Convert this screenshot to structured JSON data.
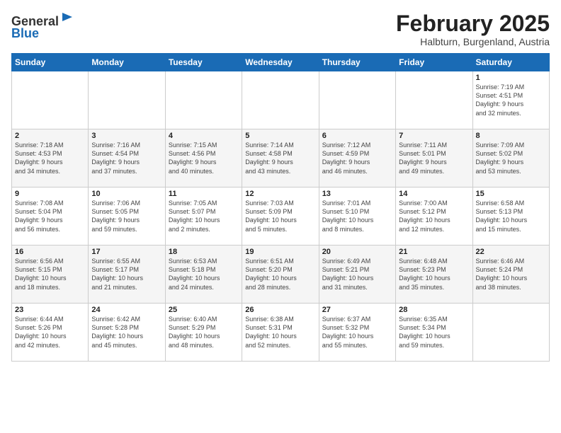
{
  "header": {
    "logo_line1": "General",
    "logo_line2": "Blue",
    "title": "February 2025",
    "subtitle": "Halbturn, Burgenland, Austria"
  },
  "days_of_week": [
    "Sunday",
    "Monday",
    "Tuesday",
    "Wednesday",
    "Thursday",
    "Friday",
    "Saturday"
  ],
  "weeks": [
    [
      {
        "day": "",
        "info": ""
      },
      {
        "day": "",
        "info": ""
      },
      {
        "day": "",
        "info": ""
      },
      {
        "day": "",
        "info": ""
      },
      {
        "day": "",
        "info": ""
      },
      {
        "day": "",
        "info": ""
      },
      {
        "day": "1",
        "info": "Sunrise: 7:19 AM\nSunset: 4:51 PM\nDaylight: 9 hours\nand 32 minutes."
      }
    ],
    [
      {
        "day": "2",
        "info": "Sunrise: 7:18 AM\nSunset: 4:53 PM\nDaylight: 9 hours\nand 34 minutes."
      },
      {
        "day": "3",
        "info": "Sunrise: 7:16 AM\nSunset: 4:54 PM\nDaylight: 9 hours\nand 37 minutes."
      },
      {
        "day": "4",
        "info": "Sunrise: 7:15 AM\nSunset: 4:56 PM\nDaylight: 9 hours\nand 40 minutes."
      },
      {
        "day": "5",
        "info": "Sunrise: 7:14 AM\nSunset: 4:58 PM\nDaylight: 9 hours\nand 43 minutes."
      },
      {
        "day": "6",
        "info": "Sunrise: 7:12 AM\nSunset: 4:59 PM\nDaylight: 9 hours\nand 46 minutes."
      },
      {
        "day": "7",
        "info": "Sunrise: 7:11 AM\nSunset: 5:01 PM\nDaylight: 9 hours\nand 49 minutes."
      },
      {
        "day": "8",
        "info": "Sunrise: 7:09 AM\nSunset: 5:02 PM\nDaylight: 9 hours\nand 53 minutes."
      }
    ],
    [
      {
        "day": "9",
        "info": "Sunrise: 7:08 AM\nSunset: 5:04 PM\nDaylight: 9 hours\nand 56 minutes."
      },
      {
        "day": "10",
        "info": "Sunrise: 7:06 AM\nSunset: 5:05 PM\nDaylight: 9 hours\nand 59 minutes."
      },
      {
        "day": "11",
        "info": "Sunrise: 7:05 AM\nSunset: 5:07 PM\nDaylight: 10 hours\nand 2 minutes."
      },
      {
        "day": "12",
        "info": "Sunrise: 7:03 AM\nSunset: 5:09 PM\nDaylight: 10 hours\nand 5 minutes."
      },
      {
        "day": "13",
        "info": "Sunrise: 7:01 AM\nSunset: 5:10 PM\nDaylight: 10 hours\nand 8 minutes."
      },
      {
        "day": "14",
        "info": "Sunrise: 7:00 AM\nSunset: 5:12 PM\nDaylight: 10 hours\nand 12 minutes."
      },
      {
        "day": "15",
        "info": "Sunrise: 6:58 AM\nSunset: 5:13 PM\nDaylight: 10 hours\nand 15 minutes."
      }
    ],
    [
      {
        "day": "16",
        "info": "Sunrise: 6:56 AM\nSunset: 5:15 PM\nDaylight: 10 hours\nand 18 minutes."
      },
      {
        "day": "17",
        "info": "Sunrise: 6:55 AM\nSunset: 5:17 PM\nDaylight: 10 hours\nand 21 minutes."
      },
      {
        "day": "18",
        "info": "Sunrise: 6:53 AM\nSunset: 5:18 PM\nDaylight: 10 hours\nand 24 minutes."
      },
      {
        "day": "19",
        "info": "Sunrise: 6:51 AM\nSunset: 5:20 PM\nDaylight: 10 hours\nand 28 minutes."
      },
      {
        "day": "20",
        "info": "Sunrise: 6:49 AM\nSunset: 5:21 PM\nDaylight: 10 hours\nand 31 minutes."
      },
      {
        "day": "21",
        "info": "Sunrise: 6:48 AM\nSunset: 5:23 PM\nDaylight: 10 hours\nand 35 minutes."
      },
      {
        "day": "22",
        "info": "Sunrise: 6:46 AM\nSunset: 5:24 PM\nDaylight: 10 hours\nand 38 minutes."
      }
    ],
    [
      {
        "day": "23",
        "info": "Sunrise: 6:44 AM\nSunset: 5:26 PM\nDaylight: 10 hours\nand 42 minutes."
      },
      {
        "day": "24",
        "info": "Sunrise: 6:42 AM\nSunset: 5:28 PM\nDaylight: 10 hours\nand 45 minutes."
      },
      {
        "day": "25",
        "info": "Sunrise: 6:40 AM\nSunset: 5:29 PM\nDaylight: 10 hours\nand 48 minutes."
      },
      {
        "day": "26",
        "info": "Sunrise: 6:38 AM\nSunset: 5:31 PM\nDaylight: 10 hours\nand 52 minutes."
      },
      {
        "day": "27",
        "info": "Sunrise: 6:37 AM\nSunset: 5:32 PM\nDaylight: 10 hours\nand 55 minutes."
      },
      {
        "day": "28",
        "info": "Sunrise: 6:35 AM\nSunset: 5:34 PM\nDaylight: 10 hours\nand 59 minutes."
      },
      {
        "day": "",
        "info": ""
      }
    ]
  ]
}
